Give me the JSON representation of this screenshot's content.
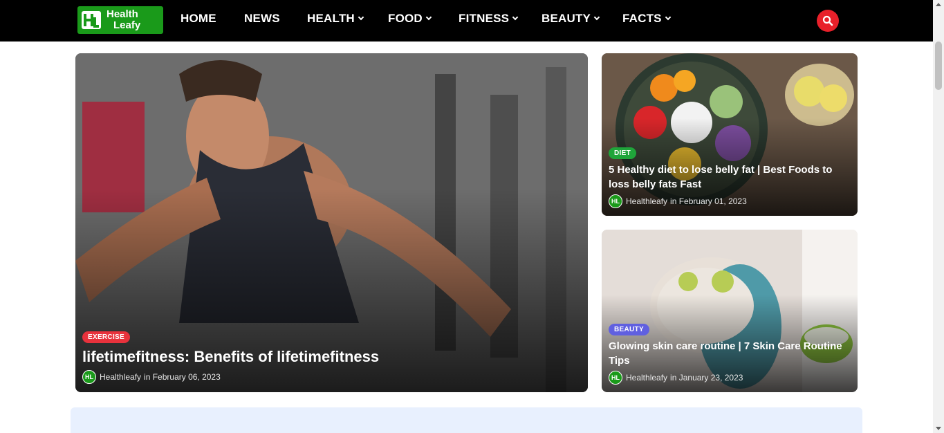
{
  "brand": {
    "name_line1": "Health",
    "name_line2": "Leafy"
  },
  "nav": {
    "home": "HOME",
    "news": "NEWS",
    "health": "HEALTH",
    "food": "FOOD",
    "fitness": "FITNESS",
    "beauty": "BEAUTY",
    "facts": "FACTS"
  },
  "colors": {
    "accent": "#1a9a1a",
    "search": "#e8202a",
    "exercise": "#e8323c",
    "diet": "#1fa53a",
    "beauty": "#6060e0"
  },
  "featured": {
    "badge": "EXERCISE",
    "title": "lifetimefitness: Benefits of lifetimefitness",
    "author": "Healthleafy",
    "date_text": "in February 06, 2023"
  },
  "side_posts": [
    {
      "badge": "DIET",
      "title": "5 Healthy diet to lose belly fat | Best Foods to loss belly fats Fast",
      "author": "Healthleafy",
      "date_text": "in February 01, 2023"
    },
    {
      "badge": "BEAUTY",
      "title": "Glowing skin care routine | 7 Skin Care Routine Tips",
      "author": "Healthleafy",
      "date_text": "in January 23, 2023"
    }
  ],
  "icons": {
    "search": "search-icon",
    "logo": "logo-icon"
  }
}
